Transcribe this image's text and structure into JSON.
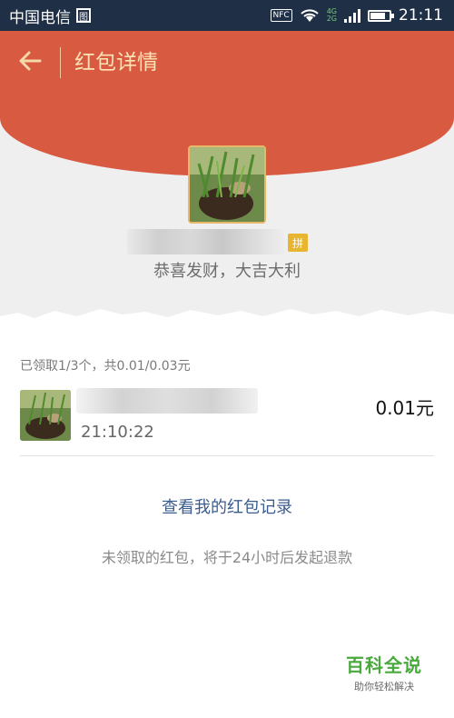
{
  "status_bar": {
    "carrier": "中国电信",
    "sim_icon_text": "图",
    "nfc": "NFC",
    "net_top": "4G",
    "net_bottom": "2G",
    "time": "21:11"
  },
  "header": {
    "title": "红包详情",
    "back_icon": "arrow-left-icon",
    "accent": "#d85a41",
    "title_color": "#fbe3b6"
  },
  "sender": {
    "badge": "拼",
    "greeting": "恭喜发财，大吉大利"
  },
  "summary": {
    "text": "已领取1/3个，共0.01/0.03元"
  },
  "receivers": [
    {
      "time": "21:10:22",
      "amount": "0.01元"
    }
  ],
  "actions": {
    "records_link": "查看我的红包记录",
    "refund_note": "未领取的红包，将于24小时后发起退款"
  },
  "watermark": {
    "main": "百科全说",
    "sub": "助你轻松解决"
  }
}
